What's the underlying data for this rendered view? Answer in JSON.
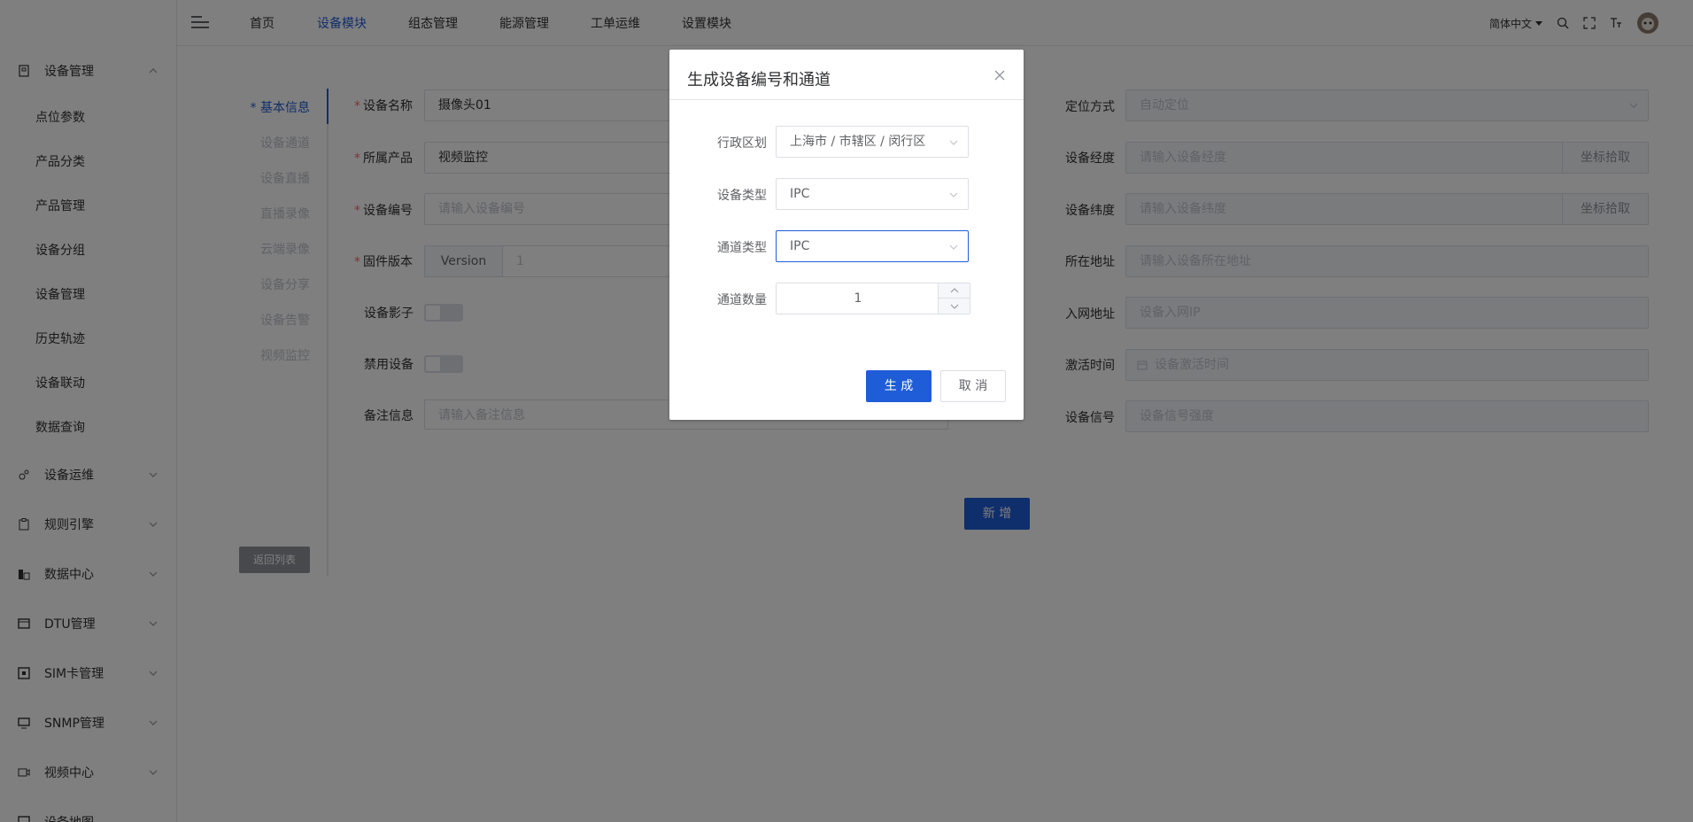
{
  "sidebar": {
    "groups": [
      {
        "label": "设备管理",
        "icon": "device-icon",
        "expanded": true
      },
      {
        "label": "设备运维",
        "icon": "maintenance-icon"
      },
      {
        "label": "规则引擎",
        "icon": "rule-icon"
      },
      {
        "label": "数据中心",
        "icon": "data-center-icon"
      },
      {
        "label": "DTU管理",
        "icon": "dtu-icon"
      },
      {
        "label": "SIM卡管理",
        "icon": "sim-icon"
      },
      {
        "label": "SNMP管理",
        "icon": "snmp-icon"
      },
      {
        "label": "视频中心",
        "icon": "video-icon"
      },
      {
        "label": "设备地图",
        "icon": "map-icon"
      }
    ],
    "sub_items": [
      "点位参数",
      "产品分类",
      "产品管理",
      "设备分组",
      "设备管理",
      "历史轨迹",
      "设备联动",
      "数据查询"
    ]
  },
  "header": {
    "nav": [
      "首页",
      "设备模块",
      "组态管理",
      "能源管理",
      "工单运维",
      "设置模块"
    ],
    "active_nav": "设备模块",
    "language": "简体中文"
  },
  "steps": [
    "基本信息",
    "设备通道",
    "设备直播",
    "直播录像",
    "云端录像",
    "设备分享",
    "设备告警",
    "视频监控"
  ],
  "active_step": "基本信息",
  "back_button": "返回列表",
  "form_left": {
    "device_name": {
      "label": "设备名称",
      "value": "摄像头01"
    },
    "product": {
      "label": "所属产品",
      "value": "视频监控"
    },
    "device_no": {
      "label": "设备编号",
      "placeholder": "请输入设备编号"
    },
    "firmware": {
      "label": "固件版本",
      "prefix": "Version",
      "value": "1"
    },
    "shadow": {
      "label": "设备影子"
    },
    "disable": {
      "label": "禁用设备"
    },
    "remark": {
      "label": "备注信息",
      "placeholder": "请输入备注信息"
    }
  },
  "form_right": {
    "locate": {
      "label": "定位方式",
      "value": "自动定位"
    },
    "lng": {
      "label": "设备经度",
      "placeholder": "请输入设备经度",
      "button": "坐标拾取"
    },
    "lat": {
      "label": "设备纬度",
      "placeholder": "请输入设备纬度",
      "button": "坐标拾取"
    },
    "address": {
      "label": "所在地址",
      "placeholder": "请输入设备所在地址"
    },
    "ip": {
      "label": "入网地址",
      "placeholder": "设备入网IP"
    },
    "activate": {
      "label": "激活时间",
      "placeholder": "设备激活时间"
    },
    "signal": {
      "label": "设备信号",
      "placeholder": "设备信号强度"
    }
  },
  "add_button": "新 增",
  "dialog": {
    "title": "生成设备编号和通道",
    "region": {
      "label": "行政区划",
      "value": "上海市 / 市辖区 / 闵行区"
    },
    "device_type": {
      "label": "设备类型",
      "value": "IPC"
    },
    "channel_type": {
      "label": "通道类型",
      "value": "IPC"
    },
    "channel_count": {
      "label": "通道数量",
      "value": "1"
    },
    "confirm": "生 成",
    "cancel": "取 消"
  },
  "colors": {
    "primary": "#1f5cd8",
    "overlay": "rgba(0,0,0,0.5)"
  }
}
